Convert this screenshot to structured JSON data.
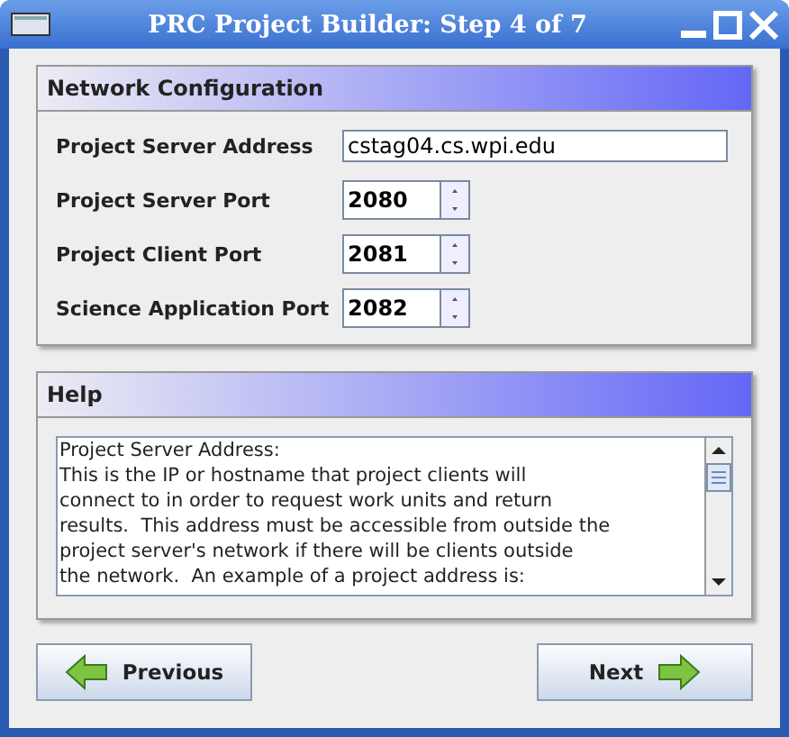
{
  "window": {
    "title": "PRC Project Builder: Step 4 of 7"
  },
  "network": {
    "title": "Network Configuration",
    "fields": [
      {
        "kind": "text",
        "label": "Project Server Address",
        "value": "cstag04.cs.wpi.edu"
      },
      {
        "kind": "spinner",
        "label": "Project Server Port",
        "value": "2080"
      },
      {
        "kind": "spinner",
        "label": "Project Client Port",
        "value": "2081"
      },
      {
        "kind": "spinner",
        "label": "Science Application Port",
        "value": "2082"
      }
    ]
  },
  "help": {
    "title": "Help",
    "lines": [
      "Project Server Address:",
      "This is the IP or hostname that project clients will",
      "connect to in order to request work units and return",
      "results.  This address must be accessible from outside the",
      "project server's network if there will be clients outside",
      "the network.  An example of a project address is:"
    ]
  },
  "buttons": [
    {
      "kind": "previous",
      "label": "Previous"
    },
    {
      "kind": "next",
      "label": "Next"
    }
  ]
}
